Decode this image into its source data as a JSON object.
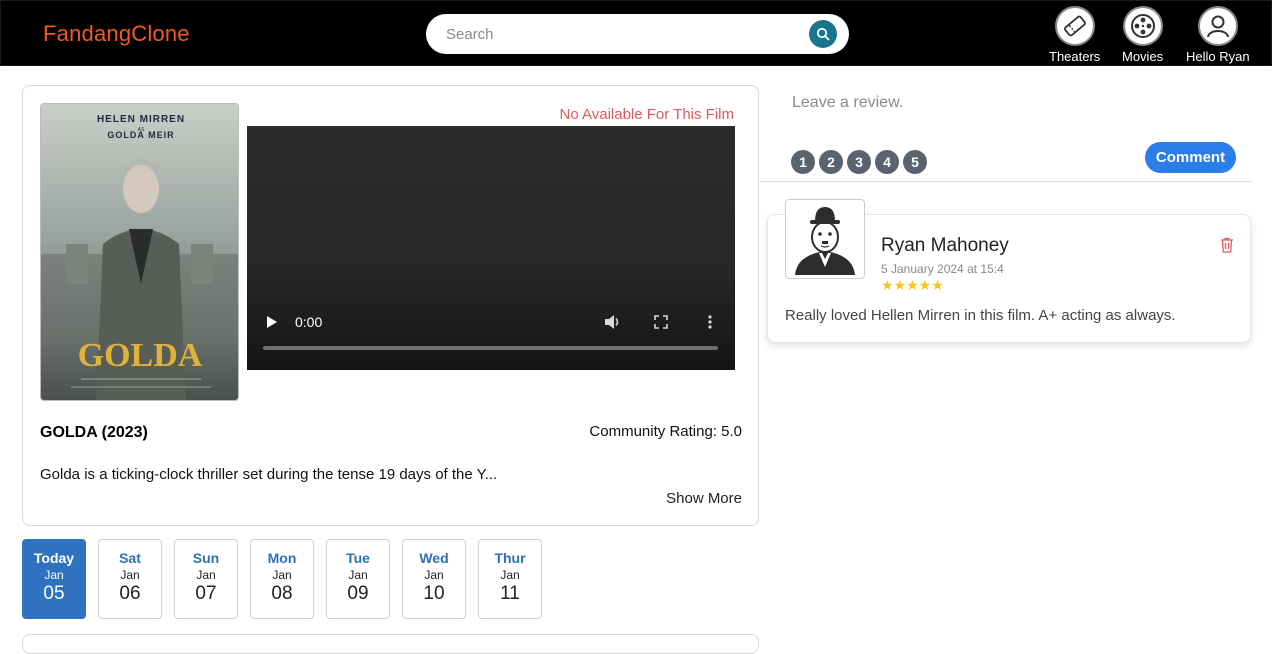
{
  "header": {
    "brand": "FandangClone",
    "search_placeholder": "Search",
    "nav": [
      {
        "label": "Theaters",
        "icon": "ticket-icon"
      },
      {
        "label": "Movies",
        "icon": "film-reel-icon"
      },
      {
        "label": "Hello Ryan",
        "icon": "user-icon"
      }
    ]
  },
  "film": {
    "title": "GOLDA (2023)",
    "rating": "Community Rating: 5.0",
    "description": "Golda is a ticking-clock thriller set during the tense 19 days of the Y...",
    "show_more": "Show More",
    "not_available": "No Available For This Film",
    "video_time": "0:00",
    "poster": {
      "actor": "HELEN MIRREN",
      "as": "AS",
      "role": "GOLDA MEIR",
      "title": "GOLDA"
    }
  },
  "dates": [
    {
      "day": "Today",
      "month": "Jan",
      "num": "05",
      "active": true
    },
    {
      "day": "Sat",
      "month": "Jan",
      "num": "06"
    },
    {
      "day": "Sun",
      "month": "Jan",
      "num": "07"
    },
    {
      "day": "Mon",
      "month": "Jan",
      "num": "08"
    },
    {
      "day": "Tue",
      "month": "Jan",
      "num": "09"
    },
    {
      "day": "Wed",
      "month": "Jan",
      "num": "10"
    },
    {
      "day": "Thur",
      "month": "Jan",
      "num": "11"
    }
  ],
  "review_form": {
    "placeholder": "Leave a review.",
    "ratings": [
      "1",
      "2",
      "3",
      "4",
      "5"
    ],
    "comment_label": "Comment"
  },
  "reviews": [
    {
      "name": "Ryan Mahoney",
      "date": "5 January 2024 at 15:4",
      "stars": "★★★★★",
      "rating": 5,
      "text": "Really loved Hellen Mirren in this film. A+ acting as always."
    }
  ],
  "colors": {
    "brand": "#f15a24",
    "accent": "#2b7de9",
    "date_active": "#2f72c0",
    "search_button": "#17758d",
    "error": "#e05a5a",
    "star": "#f5c518"
  }
}
